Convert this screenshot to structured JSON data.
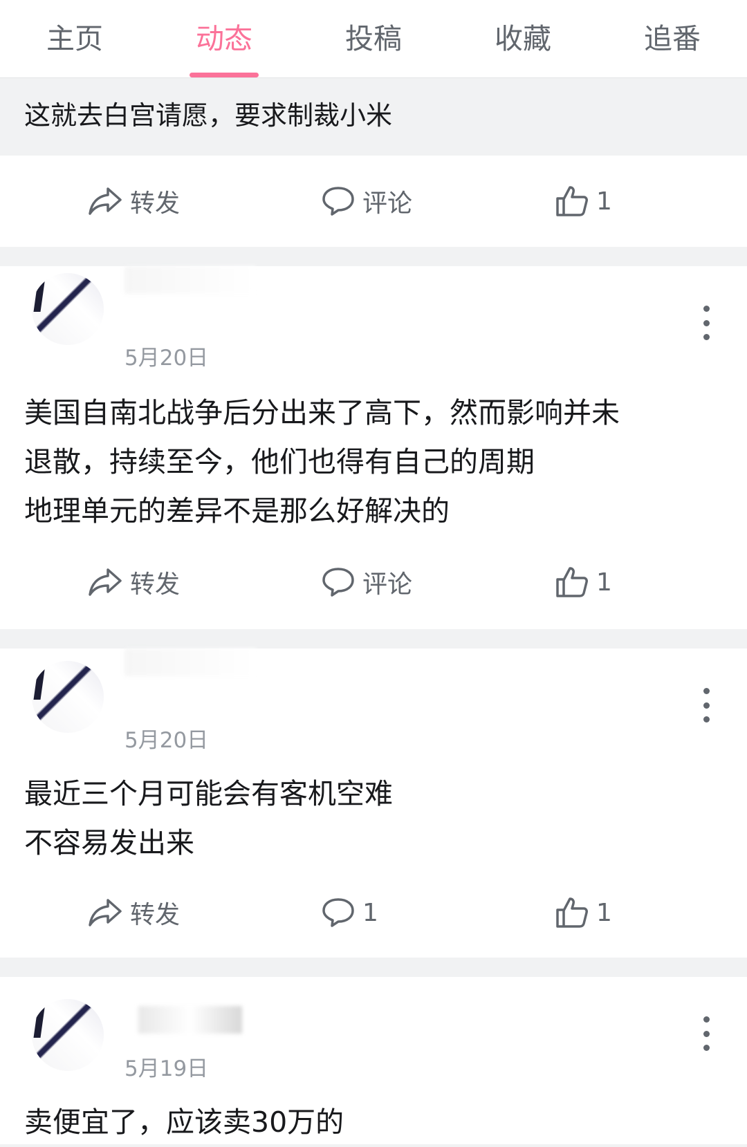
{
  "tabs": [
    {
      "label": "主页"
    },
    {
      "label": "动态"
    },
    {
      "label": "投稿"
    },
    {
      "label": "收藏"
    },
    {
      "label": "追番"
    }
  ],
  "active_tab": "动态",
  "colors": {
    "accent": "#fb7299",
    "text": "#18191c",
    "muted": "#61666d",
    "date": "#9499a0",
    "bg": "#f1f2f3"
  },
  "quote_text": "这就去白宫请愿，要求制裁小米",
  "first_actions": {
    "forward": "转发",
    "comment": "评论",
    "like": "1"
  },
  "posts": [
    {
      "date": "5月20日",
      "lines": [
        "美国自南北战争后分出来了高下，然而影响并未",
        "退散，持续至今，他们也得有自己的周期",
        "地理单元的差异不是那么好解决的"
      ],
      "actions": {
        "forward": "转发",
        "comment": "评论",
        "like": "1"
      }
    },
    {
      "date": "5月20日",
      "lines": [
        "最近三个月可能会有客机空难",
        "不容易发出来"
      ],
      "actions": {
        "forward": "转发",
        "comment": "1",
        "like": "1"
      }
    },
    {
      "date": "5月19日",
      "lines": [
        "卖便宜了，应该卖30万的"
      ]
    }
  ]
}
